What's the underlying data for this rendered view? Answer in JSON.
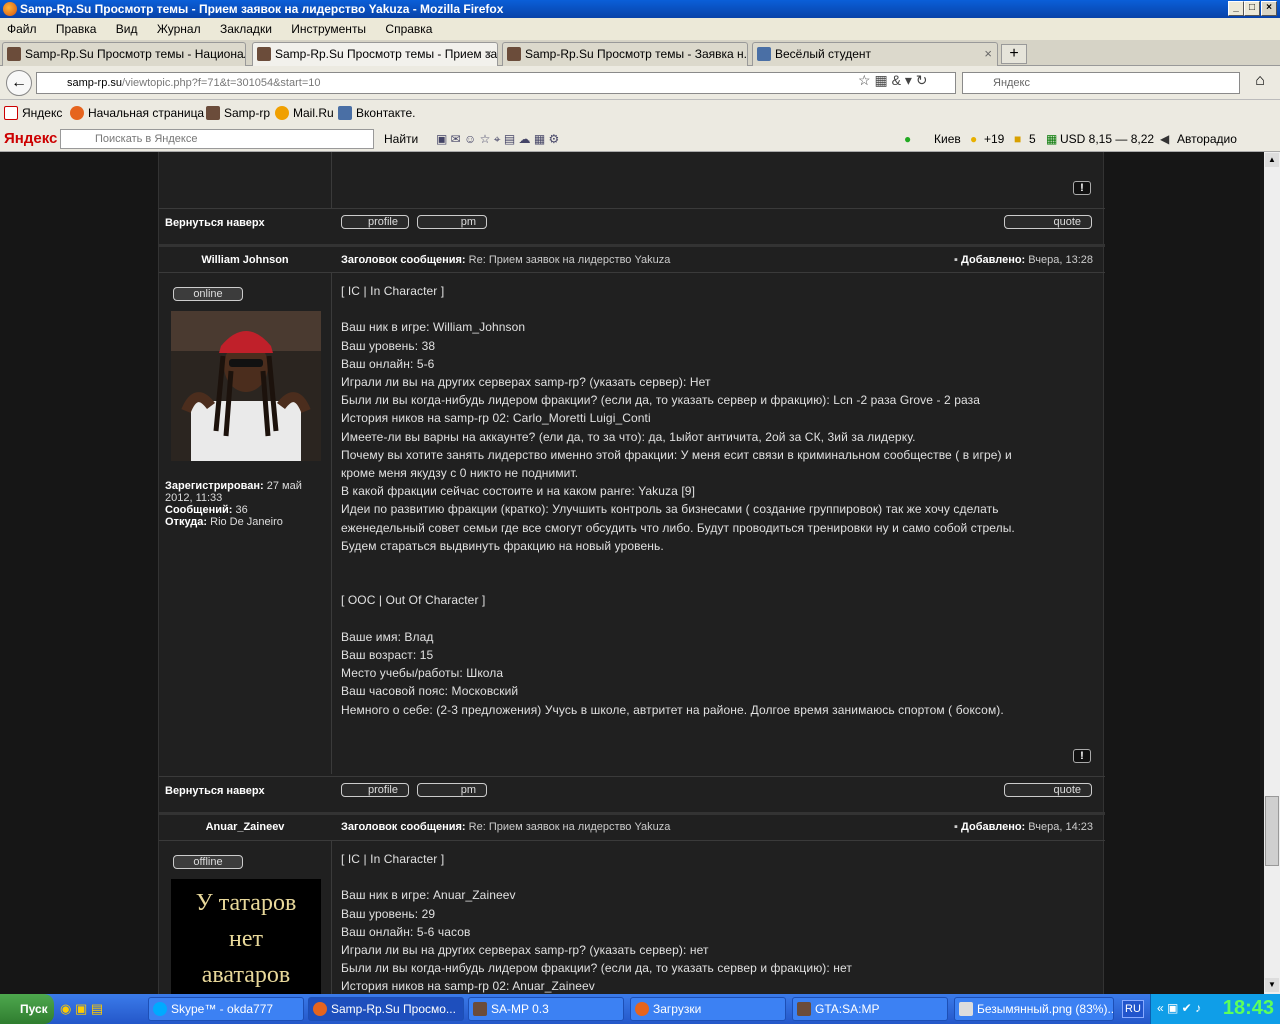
{
  "window": {
    "title": "Samp-Rp.Su Просмотр темы - Прием заявок на лидерство Yakuza - Mozilla Firefox",
    "buttons": [
      "_",
      "□",
      "×"
    ]
  },
  "menu": [
    "Файл",
    "Правка",
    "Вид",
    "Журнал",
    "Закладки",
    "Инструменты",
    "Справка"
  ],
  "tabs": [
    {
      "label": "Samp-Rp.Su Просмотр темы - Национал...",
      "active": false
    },
    {
      "label": "Samp-Rp.Su Просмотр темы - Прием за...",
      "active": true
    },
    {
      "label": "Samp-Rp.Su Просмотр темы - Заявка н...",
      "active": false
    },
    {
      "label": "Весёлый студент",
      "active": false
    }
  ],
  "newtab": "+",
  "nav": {
    "url_host": "samp-rp.su",
    "url_path": "/viewtopic.php?f=71&t=301054&start=10",
    "search_placeholder": "Яндекс"
  },
  "bookmarks": [
    "Яндекс",
    "Начальная страница",
    "Samp-rp",
    "Mail.Ru",
    "Вконтакте."
  ],
  "yandex_bar": {
    "logo": "Яндекс",
    "search_placeholder": "Поискать в Яндексе",
    "find": "Найти",
    "city": "Киев",
    "temp": "+19",
    "traffic": "5",
    "usd": "USD 8,15 — 8,22",
    "radio": "Авторадио"
  },
  "forum": {
    "back_to_top": "Вернуться наверх",
    "profile_label": "profile",
    "pm_label": "pm",
    "quote_label": "quote",
    "subject_label": "Заголовок сообщения:",
    "added_label": "Добавлено:",
    "report": "!",
    "posts": [
      {
        "author": "William Johnson",
        "status": "online",
        "subject": "Re: Прием заявок на лидерство Yakuza",
        "time": "Вчера, 13:28",
        "reg_label": "Зарегистрирован:",
        "reg": "27 май 2012, 11:33",
        "msgs_label": "Сообщений:",
        "msgs": "36",
        "from_label": "Откуда:",
        "from": "Rio De Janeiro",
        "body": "[ IC | In Character ]\n\nВаш ник в игре: William_Johnson\nВаш уровень: 38\nВаш онлайн: 5-6\nИграли ли вы на других серверах samp-rp? (указать сервер): Нет\nБыли ли вы когда-нибудь лидером фракции? (если да, то указать сервер и фракцию): Lcn -2 раза Grove - 2 раза\nИстория ников на samp-rp 02: Carlo_Moretti Luigi_Conti\nИмеете-ли вы варны на аккаунте? (ели да, то за что): да, 1ыйот античита, 2ой за СК, 3ий за лидерку.\nПочему вы хотите занять лидерство именно этой фракции: У меня есит связи в криминальном сообществе ( в игре) и\nкроме меня якудзу с 0 никто не поднимит.\nВ какой фракции сейчас состоите и на каком ранге: Yakuza [9]\nИдеи по развитию фракции (кратко): Улучшить контроль за бизнесами ( создание группировок) так же хочу сделать\nеженедельный совет семьи где все смогут обсудить что либо. Будут проводиться тренировки ну и само собой стрелы.\nБудем стараться выдвинуть фракцию на новый уровень.\n\n\n[ OOC | Out Of Character ]\n\nВаше имя: Влад\nВаш возраст: 15\nМесто учебы/работы: Школа\nВаш часовой пояс: Московский\nНемного о себе: (2-3 предложения) Учусь в школе, автритет на районе. Долгое время занимаюсь спортом ( боксом)."
      },
      {
        "author": "Anuar_Zaineev",
        "status": "offline",
        "subject": "Re: Прием заявок на лидерство Yakuza",
        "time": "Вчера, 14:23",
        "avatar_text": "У татаров\nнет\nаватаров",
        "body": "[ IC | In Character ]\n\nВаш ник в игре: Anuar_Zaineev\nВаш уровень: 29\nВаш онлайн: 5-6 часов\nИграли ли вы на других серверах samp-rp? (указать сервер): нет\nБыли ли вы когда-нибудь лидером фракции? (если да, то указать сервер и фракцию): нет\nИстория ников на samp-rp 02: Anuar_Zaineev"
      }
    ]
  },
  "taskbar": {
    "start": "Пуск",
    "items": [
      "Skype™ - okda777",
      "Samp-Rp.Su Просмо...",
      "SA-MP 0.3",
      "Загрузки",
      "GTA:SA:MP",
      "Безымянный.png (83%)..."
    ],
    "lang": "RU",
    "clock": "18:43"
  }
}
